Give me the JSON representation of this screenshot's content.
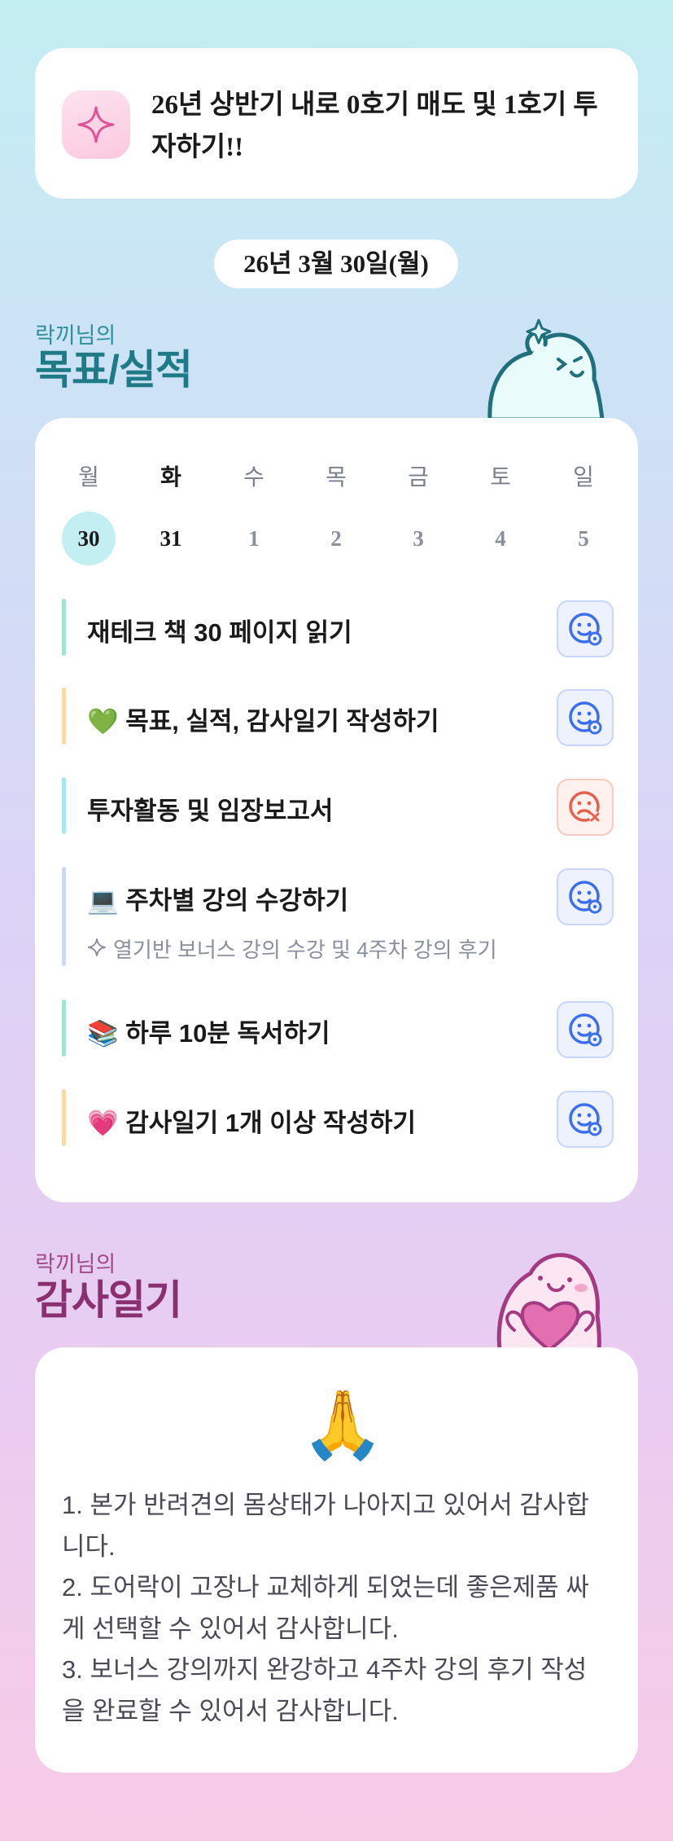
{
  "goal": {
    "text": "26년 상반기 내로 0호기 매도 및 1호기 투자하기!!",
    "icon": "sparkle-icon"
  },
  "date": "26년 3월 30일(월)",
  "goals_section": {
    "owner": "락끼님의",
    "title": "목표/실적"
  },
  "week": {
    "days": [
      "월",
      "화",
      "수",
      "목",
      "금",
      "토",
      "일"
    ],
    "dates": [
      "30",
      "31",
      "1",
      "2",
      "3",
      "4",
      "5"
    ]
  },
  "tasks": [
    {
      "label": "재테크 책 30 페이지 읽기",
      "status": "done",
      "bar_color": "#9fe3d3"
    },
    {
      "label": "💚 목표, 실적, 감사일기 작성하기",
      "status": "done",
      "bar_color": "#f9d9a8"
    },
    {
      "label": "투자활동 및 임장보고서",
      "status": "failed",
      "bar_color": "#a7e8ef"
    },
    {
      "label": "💻 주차별 강의 수강하기",
      "sub": "열기반 보너스 강의 수강 및 4주차 강의 후기",
      "status": "done",
      "bar_color": "#cdd8f7"
    },
    {
      "label": "📚 하루 10분 독서하기",
      "status": "done",
      "bar_color": "#9fe3d3"
    },
    {
      "label": "💗 감사일기 1개 이상 작성하기",
      "status": "done",
      "bar_color": "#f9d9a8"
    }
  ],
  "thanks_section": {
    "owner": "락끼님의",
    "title": "감사일기"
  },
  "thanks": {
    "emoji": "🙏",
    "lines": [
      "1. 본가 반려견의 몸상태가 나아지고 있어서 감사합",
      "니다.",
      "2. 도어락이 고장나 교체하게 되었는데 좋은제품 싸",
      "게 선택할 수 있어서 감사합니다.",
      "3. 보너스 강의까지 완강하고 4주차 강의 후기 작성",
      "을 완료할 수 있어서 감사합니다."
    ]
  },
  "colors": {
    "accent_teal": "#1e7a86",
    "accent_plum": "#8a2f70",
    "status_ok": "#3b6ff0",
    "status_bad": "#e8604c"
  }
}
